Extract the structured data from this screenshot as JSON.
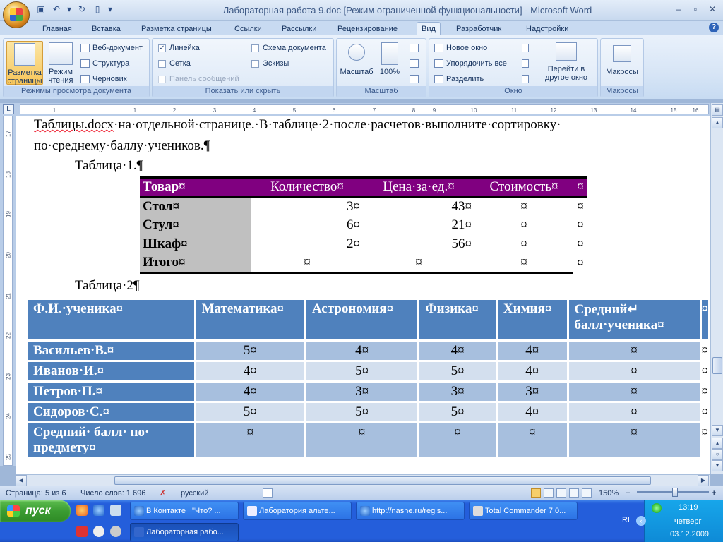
{
  "window": {
    "title": "Лабораторная работа 9.doc [Режим ограниченной функциональности] - Microsoft Word",
    "minimize": "–",
    "restore": "▫",
    "close": "✕"
  },
  "tabs": [
    "Главная",
    "Вставка",
    "Разметка страницы",
    "Ссылки",
    "Рассылки",
    "Рецензирование",
    "Вид",
    "Разработчик",
    "Надстройки"
  ],
  "active_tab": "Вид",
  "help": "?",
  "ribbon": {
    "views": {
      "label": "Режимы просмотра документа",
      "print_layout": "Разметка страницы",
      "reading": "Режим чтения",
      "web": "Веб-документ",
      "outline": "Структура",
      "draft": "Черновик"
    },
    "show": {
      "label": "Показать или скрыть",
      "ruler": "Линейка",
      "grid": "Сетка",
      "message_bar": "Панель сообщений",
      "doc_map": "Схема документа",
      "thumbnails": "Эскизы",
      "check": "✓"
    },
    "zoom": {
      "label": "Масштаб",
      "zoom_btn": "Масштаб",
      "percent_btn": "100%"
    },
    "window": {
      "label": "Окно",
      "new_window": "Новое окно",
      "arrange_all": "Упорядочить все",
      "split": "Разделить",
      "switch": "Перейти в другое окно"
    },
    "macros": {
      "label": "Макросы",
      "macros_btn": "Макросы"
    }
  },
  "ruler": {
    "corner": "L",
    "h_ticks": [
      "1",
      "1",
      "2",
      "3",
      "4",
      "5",
      "6",
      "7",
      "8",
      "9",
      "10",
      "11",
      "12",
      "13",
      "14",
      "15",
      "16",
      "17"
    ],
    "v_ticks": [
      "17",
      "18",
      "19",
      "20",
      "21",
      "22",
      "23",
      "24",
      "25"
    ]
  },
  "document": {
    "line1a": "Таблицы.docx",
    "line1b": "·на·отдельной·странице.·В·таблице·2·после·расчетов·выполните·сортировку·",
    "line2": "по·среднему·баллу·учеников.¶",
    "caption1": "Таблица·1.¶",
    "caption2": "Таблица·2¶",
    "cell_end": "¤",
    "table1": {
      "headers": [
        "Товар¤",
        "Количество¤",
        "Цена·за·ед.¤",
        "Стоимость¤"
      ],
      "rows": [
        [
          "Стол¤",
          "3¤",
          "43¤",
          "¤"
        ],
        [
          "Стул¤",
          "6¤",
          "21¤",
          "¤"
        ],
        [
          "Шкаф¤",
          "2¤",
          "56¤",
          "¤"
        ],
        [
          "Итого¤",
          "¤",
          "¤",
          "¤"
        ]
      ]
    },
    "table2": {
      "headers": [
        "Ф.И.·ученика¤",
        "Математика¤",
        "Астрономия¤",
        "Физика¤",
        "Химия¤",
        "Средний↵ балл·ученика¤"
      ],
      "rows": [
        [
          "Васильев·В.¤",
          "5¤",
          "4¤",
          "4¤",
          "4¤",
          "¤"
        ],
        [
          "Иванов·И.¤",
          "4¤",
          "5¤",
          "5¤",
          "4¤",
          "¤"
        ],
        [
          "Петров·П.¤",
          "4¤",
          "3¤",
          "3¤",
          "3¤",
          "¤"
        ],
        [
          "Сидоров·С.¤",
          "5¤",
          "5¤",
          "5¤",
          "4¤",
          "¤"
        ],
        [
          "Средний· балл· по· предмету¤",
          "¤",
          "¤",
          "¤",
          "¤",
          "¤"
        ]
      ]
    }
  },
  "status": {
    "page": "Страница: 5 из 6",
    "words": "Число слов: 1 696",
    "lang": "русский",
    "zoom": "150%",
    "zoom_minus": "−",
    "zoom_plus": "+"
  },
  "taskbar": {
    "start": "пуск",
    "buttons": [
      "В Контакте | \"Что? ...",
      "Лаборатория альте...",
      "http://nashe.ru/regis...",
      "Total Commander 7.0...",
      "Лабораторная рабо..."
    ],
    "tray": {
      "lang": "RL",
      "time": "13:19",
      "day": "четверг",
      "date": "03.12.2009"
    }
  }
}
